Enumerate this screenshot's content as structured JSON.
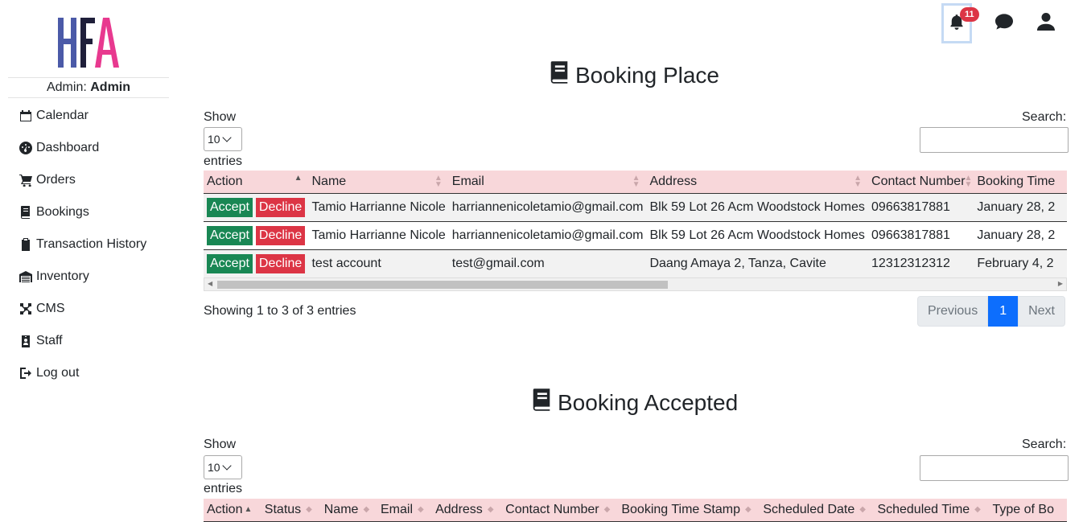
{
  "sidebar": {
    "logo_text": "HFA",
    "admin_label": "Admin:",
    "admin_name": "Admin",
    "items": [
      {
        "label": "Calendar",
        "icon": "calendar-icon"
      },
      {
        "label": "Dashboard",
        "icon": "dashboard-icon"
      },
      {
        "label": "Orders",
        "icon": "cart-icon"
      },
      {
        "label": "Bookings",
        "icon": "book-icon"
      },
      {
        "label": "Transaction History",
        "icon": "clipboard-icon"
      },
      {
        "label": "Inventory",
        "icon": "warehouse-icon"
      },
      {
        "label": "CMS",
        "icon": "cms-icon"
      },
      {
        "label": "Staff",
        "icon": "id-badge-icon"
      },
      {
        "label": "Log out",
        "icon": "logout-icon"
      }
    ]
  },
  "topbar": {
    "notification_count": "11"
  },
  "booking_place": {
    "title": "Booking Place",
    "show_label": "Show",
    "entries_value": "10",
    "entries_label": "entries",
    "search_label": "Search:",
    "columns": [
      "Action",
      "Name",
      "Email",
      "Address",
      "Contact Number",
      "Booking Time"
    ],
    "accept_label": "Accept",
    "decline_label": "Decline",
    "rows": [
      {
        "name": "Tamio Harrianne Nicole",
        "email": "harriannenicoletamio@gmail.com",
        "address": "Blk 59 Lot 26 Acm Woodstock Homes",
        "contact": "09663817881",
        "time": "January 28, 2"
      },
      {
        "name": "Tamio Harrianne Nicole",
        "email": "harriannenicoletamio@gmail.com",
        "address": "Blk 59 Lot 26 Acm Woodstock Homes",
        "contact": "09663817881",
        "time": "January 28, 2"
      },
      {
        "name": "test account",
        "email": "test@gmail.com",
        "address": "Daang Amaya 2, Tanza, Cavite",
        "contact": "12312312312",
        "time": "February 4, 2"
      }
    ],
    "info": "Showing 1 to 3 of 3 entries",
    "prev_label": "Previous",
    "page": "1",
    "next_label": "Next"
  },
  "booking_accepted": {
    "title": "Booking Accepted",
    "show_label": "Show",
    "entries_value": "10",
    "entries_label": "entries",
    "search_label": "Search:",
    "columns": [
      "Action",
      "Status",
      "Name",
      "Email",
      "Address",
      "Contact Number",
      "Booking Time Stamp",
      "Scheduled Date",
      "Scheduled Time",
      "Type of Bo"
    ]
  }
}
